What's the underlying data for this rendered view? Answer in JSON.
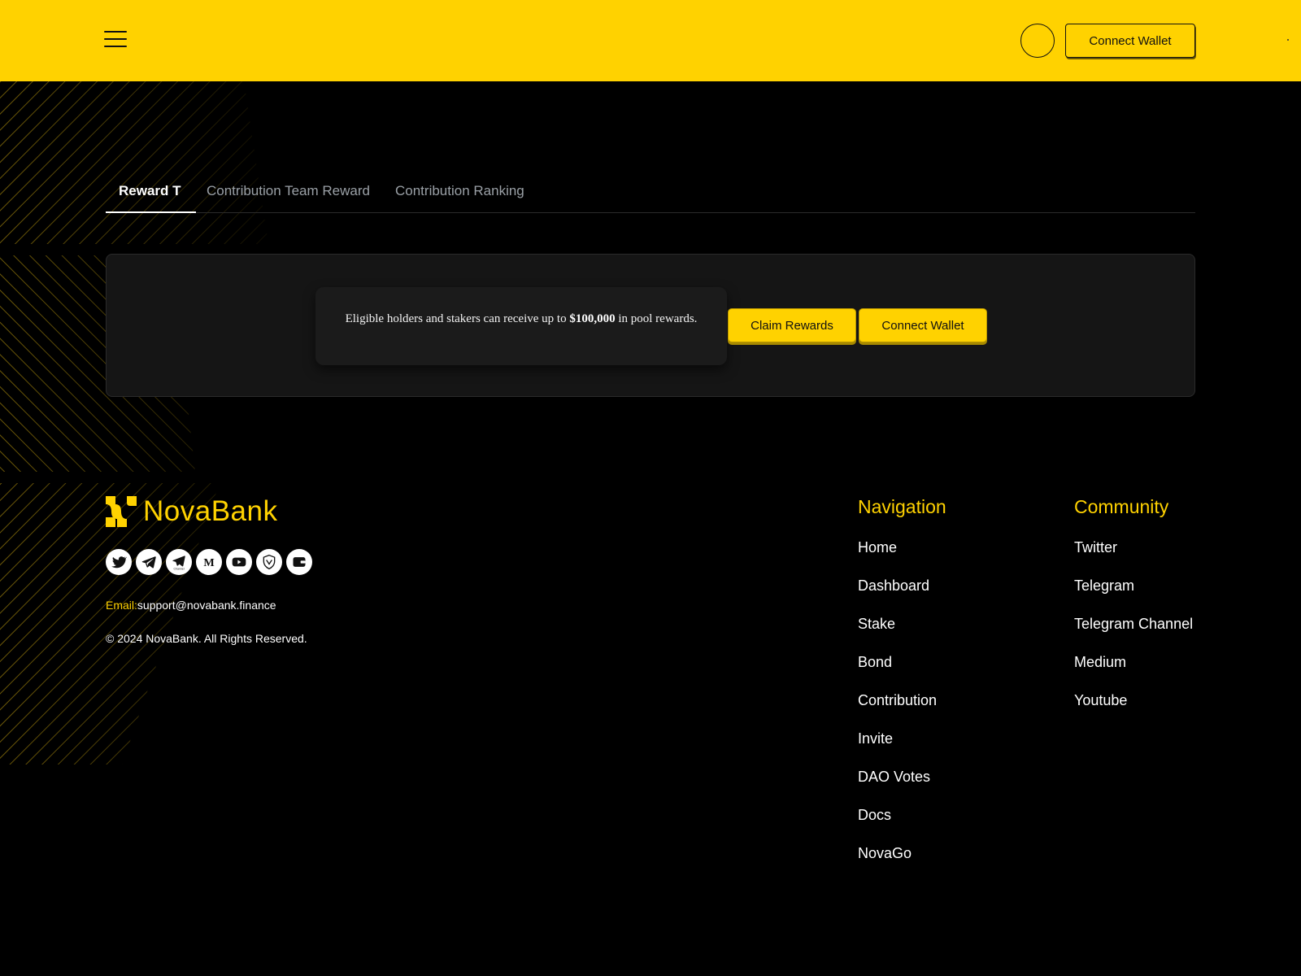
{
  "header": {
    "menu_icon": "hamburger-menu-icon",
    "connect_wallet_label": "Connect Wallet",
    "brand_color": "#ffd200"
  },
  "tabs": [
    {
      "label": "Reward T",
      "active": true
    },
    {
      "label": "Contribution Team Reward",
      "active": false
    },
    {
      "label": "Contribution Ranking",
      "active": false
    }
  ],
  "reward_panel": {
    "text_before": "Eligible holders and stakers can receive up to ",
    "amount": "$100,000",
    "text_after": " in pool rewards.",
    "claim_label": "Claim Rewards",
    "connect_label": "Connect Wallet"
  },
  "footer": {
    "brand_name": "NovaBank",
    "socials": [
      "twitter-icon",
      "telegram-icon",
      "telegram-channel-icon",
      "medium-icon",
      "youtube-icon",
      "shield-icon",
      "wallet-icon"
    ],
    "email_label": "Email:",
    "email_value": "support@novabank.finance",
    "copyright": "© 2024 NovaBank. All Rights Reserved.",
    "navigation": {
      "title": "Navigation",
      "items": [
        "Home",
        "Dashboard",
        "Stake",
        "Bond",
        "Contribution",
        "Invite",
        "DAO Votes",
        "Docs",
        "NovaGo"
      ]
    },
    "community": {
      "title": "Community",
      "items": [
        "Twitter",
        "Telegram",
        "Telegram Channel",
        "Medium",
        "Youtube"
      ]
    }
  }
}
